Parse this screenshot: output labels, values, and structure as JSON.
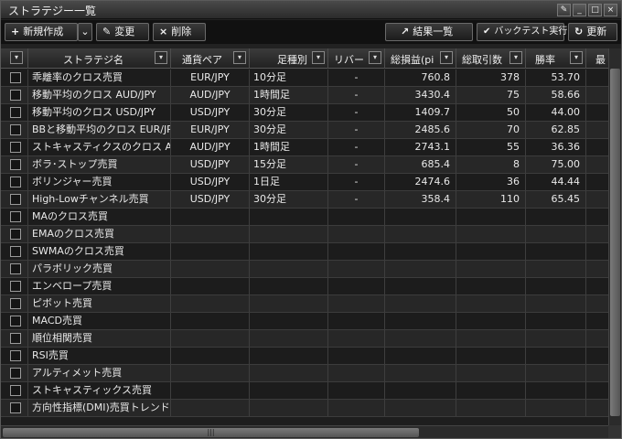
{
  "window": {
    "title": "ストラテジー一覧"
  },
  "window_buttons": [
    {
      "name": "wrench-button",
      "glyph": "✎"
    },
    {
      "name": "minimize-button",
      "glyph": "_"
    },
    {
      "name": "maximize-button",
      "glyph": "□"
    },
    {
      "name": "close-button",
      "glyph": "×"
    }
  ],
  "toolbar": {
    "new_icon": "+",
    "new_label": "新規作成",
    "new_dropdown": "⌄",
    "edit_icon": "✎",
    "edit_label": "変更",
    "delete_icon": "×",
    "delete_label": "削除",
    "results_icon": "↗",
    "results_label": "結果一覧",
    "backtest_icon": "✔",
    "backtest_label": "バックテスト実行",
    "refresh_icon": "↻",
    "refresh_label": "更新"
  },
  "columns": {
    "select": "",
    "name": "ストラテジ名",
    "pair": "通貨ペア",
    "timeframe": "足種別",
    "leverage": "リバー",
    "profit": "総損益(pi",
    "trades": "総取引数",
    "winrate": "勝率",
    "max": "最"
  },
  "filter_glyph": "▾",
  "rows": [
    {
      "name": "乖離率のクロス売買",
      "pair": "EUR/JPY",
      "timeframe": "10分足",
      "leverage": "-",
      "profit": "760.8",
      "trades": "378",
      "winrate": "53.70"
    },
    {
      "name": "移動平均のクロス AUD/JPY",
      "pair": "AUD/JPY",
      "timeframe": "1時間足",
      "leverage": "-",
      "profit": "3430.4",
      "trades": "75",
      "winrate": "58.66"
    },
    {
      "name": "移動平均のクロス USD/JPY",
      "pair": "USD/JPY",
      "timeframe": "30分足",
      "leverage": "-",
      "profit": "1409.7",
      "trades": "50",
      "winrate": "44.00"
    },
    {
      "name": "BBと移動平均のクロス EUR/JPY",
      "pair": "EUR/JPY",
      "timeframe": "30分足",
      "leverage": "-",
      "profit": "2485.6",
      "trades": "70",
      "winrate": "62.85"
    },
    {
      "name": "ストキャスティクスのクロス AUD/JPY",
      "pair": "AUD/JPY",
      "timeframe": "1時間足",
      "leverage": "-",
      "profit": "2743.1",
      "trades": "55",
      "winrate": "36.36"
    },
    {
      "name": "ボラ･ストップ売買",
      "pair": "USD/JPY",
      "timeframe": "15分足",
      "leverage": "-",
      "profit": "685.4",
      "trades": "8",
      "winrate": "75.00"
    },
    {
      "name": "ボリンジャー売買",
      "pair": "USD/JPY",
      "timeframe": "1日足",
      "leverage": "-",
      "profit": "2474.6",
      "trades": "36",
      "winrate": "44.44"
    },
    {
      "name": "High-Lowチャンネル売買",
      "pair": "USD/JPY",
      "timeframe": "30分足",
      "leverage": "-",
      "profit": "358.4",
      "trades": "110",
      "winrate": "65.45"
    },
    {
      "name": "MAのクロス売買",
      "pair": "",
      "timeframe": "",
      "leverage": "",
      "profit": "",
      "trades": "",
      "winrate": ""
    },
    {
      "name": "EMAのクロス売買",
      "pair": "",
      "timeframe": "",
      "leverage": "",
      "profit": "",
      "trades": "",
      "winrate": ""
    },
    {
      "name": "SWMAのクロス売買",
      "pair": "",
      "timeframe": "",
      "leverage": "",
      "profit": "",
      "trades": "",
      "winrate": ""
    },
    {
      "name": "パラボリック売買",
      "pair": "",
      "timeframe": "",
      "leverage": "",
      "profit": "",
      "trades": "",
      "winrate": ""
    },
    {
      "name": "エンベロープ売買",
      "pair": "",
      "timeframe": "",
      "leverage": "",
      "profit": "",
      "trades": "",
      "winrate": ""
    },
    {
      "name": "ピボット売買",
      "pair": "",
      "timeframe": "",
      "leverage": "",
      "profit": "",
      "trades": "",
      "winrate": ""
    },
    {
      "name": "MACD売買",
      "pair": "",
      "timeframe": "",
      "leverage": "",
      "profit": "",
      "trades": "",
      "winrate": ""
    },
    {
      "name": "順位相関売買",
      "pair": "",
      "timeframe": "",
      "leverage": "",
      "profit": "",
      "trades": "",
      "winrate": ""
    },
    {
      "name": "RSI売買",
      "pair": "",
      "timeframe": "",
      "leverage": "",
      "profit": "",
      "trades": "",
      "winrate": ""
    },
    {
      "name": "アルティメット売買",
      "pair": "",
      "timeframe": "",
      "leverage": "",
      "profit": "",
      "trades": "",
      "winrate": ""
    },
    {
      "name": "ストキャスティックス売買",
      "pair": "",
      "timeframe": "",
      "leverage": "",
      "profit": "",
      "trades": "",
      "winrate": ""
    },
    {
      "name": "方向性指標(DMI)売買トレンド系",
      "pair": "",
      "timeframe": "",
      "leverage": "",
      "profit": "",
      "trades": "",
      "winrate": ""
    }
  ],
  "scrollbar_grip": "|||"
}
